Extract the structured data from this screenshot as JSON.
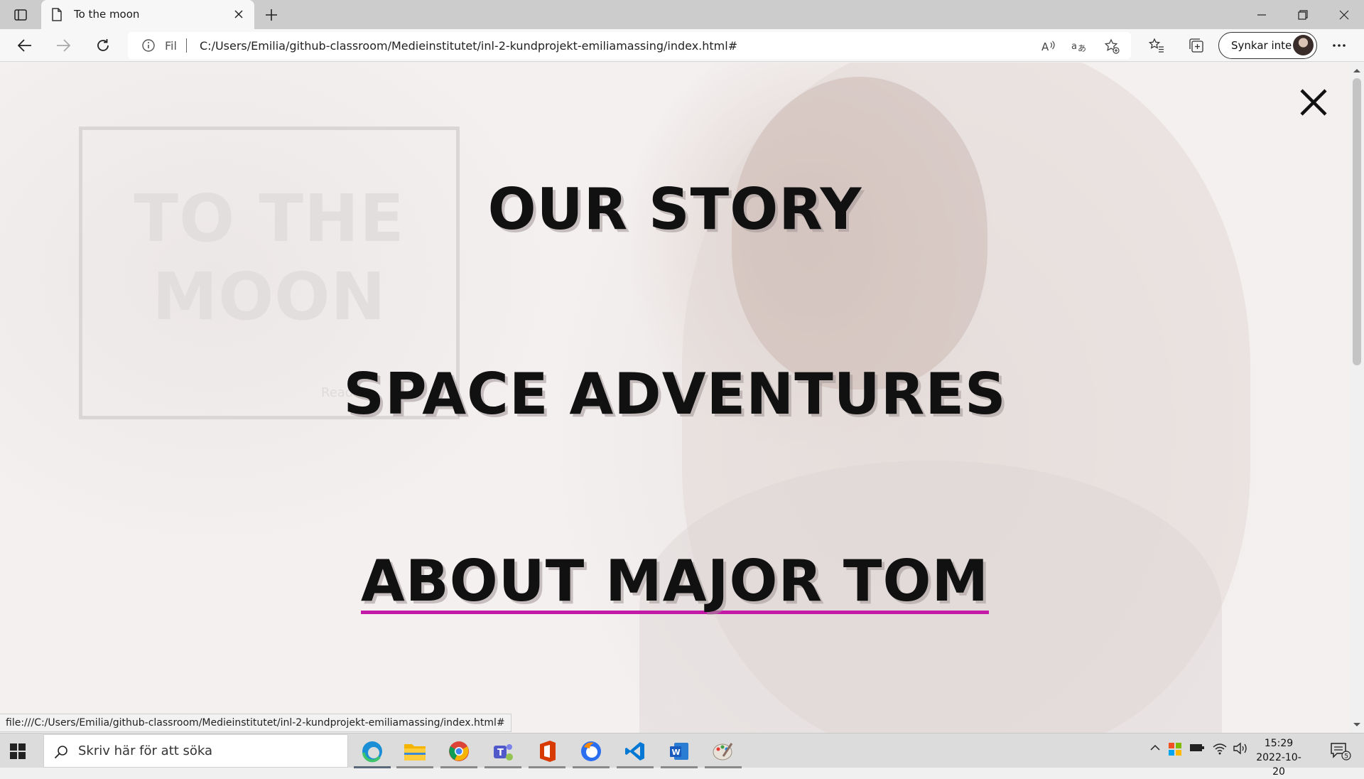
{
  "browser": {
    "tab_title": "To the moon",
    "address_prefix": "Fil",
    "url": "C:/Users/Emilia/github-classroom/Medieinstitutet/inl-2-kundprojekt-emiliamassing/index.html#",
    "sync_label": "Synkar inte",
    "status_url": "file:///C:/Users/Emilia/github-classroom/Medieinstitutet/inl-2-kundprojekt-emiliamassing/index.html#"
  },
  "page": {
    "brand_line1": "TO THE",
    "brand_line2": "MOON",
    "brand_read": "Read",
    "menu": [
      {
        "label": "OUR STORY"
      },
      {
        "label": "SPACE ADVENTURES"
      },
      {
        "label": "ABOUT MAJOR TOM"
      }
    ],
    "accent_color": "#c21aa7"
  },
  "taskbar": {
    "search_placeholder": "Skriv här för att söka",
    "time": "15:29",
    "date": "2022-10-20",
    "notification_count": "5"
  }
}
